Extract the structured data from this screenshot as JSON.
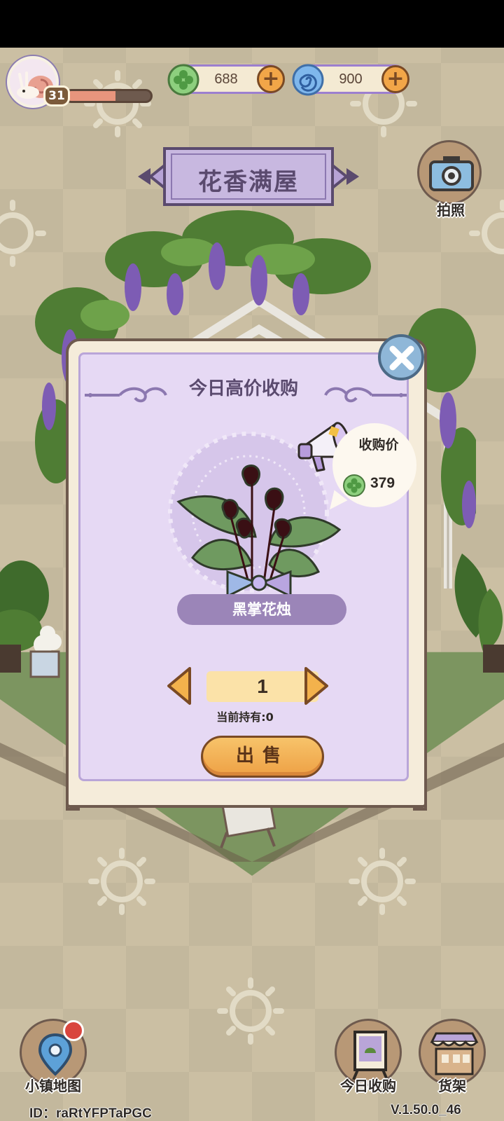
{
  "player": {
    "level": "31",
    "xp_fraction": 0.58
  },
  "currencies": [
    {
      "icon": "clover-coin-icon",
      "value": "688"
    },
    {
      "icon": "spiral-gem-icon",
      "value": "900"
    }
  ],
  "header": {
    "title": "花香满屋"
  },
  "camera": {
    "label": "拍照"
  },
  "popup": {
    "title": "今日高价收购",
    "price_label": "收购价",
    "price_value": "379",
    "item_name": "黑掌花烛",
    "quantity": "1",
    "holding_text": "当前持有:0",
    "sell_label": "出售"
  },
  "bottom_nav": {
    "map_label": "小镇地图",
    "today_label": "今日收购",
    "shelf_label": "货架"
  },
  "footer": {
    "user_id": "ID：raRtYFPTaPGC",
    "version": "V.1.50.0_46"
  },
  "colors": {
    "accent_purple": "#9b85b8",
    "sell_orange": "#eea145",
    "panel_lilac": "#e6d9f4"
  }
}
